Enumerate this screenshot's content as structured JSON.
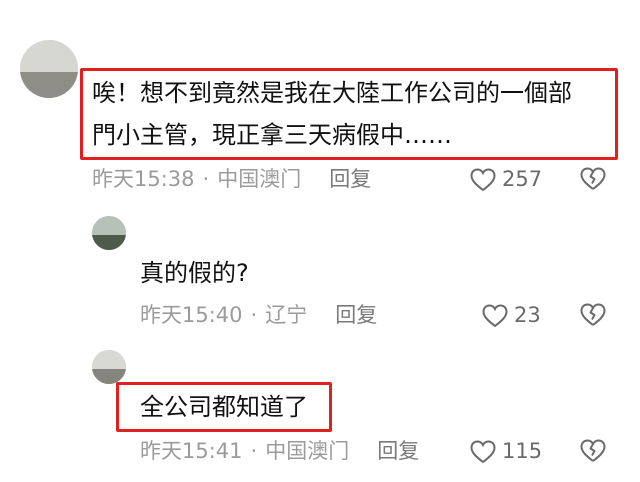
{
  "comments": [
    {
      "text_lines": [
        "唉！想不到竟然是我在大陸工作公司的一個部",
        "門小主管，現正拿三天病假中……"
      ],
      "time": "昨天15:38",
      "location": "中国澳门",
      "reply_label": "回复",
      "likes": "257",
      "highlighted": true
    },
    {
      "text_lines": [
        "真的假的?"
      ],
      "time": "昨天15:40",
      "location": "辽宁",
      "reply_label": "回复",
      "likes": "23",
      "highlighted": false
    },
    {
      "text_lines": [
        "全公司都知道了"
      ],
      "time": "昨天15:41",
      "location": "中国澳门",
      "reply_label": "回复",
      "likes": "115",
      "highlighted": true
    }
  ],
  "separator": "·",
  "icons": {
    "like": "heart-outline-icon",
    "dislike": "broken-heart-icon"
  },
  "colors": {
    "highlight": "#e0211f",
    "meta_text": "#9b9b9b",
    "icon": "#6a6a6a"
  }
}
